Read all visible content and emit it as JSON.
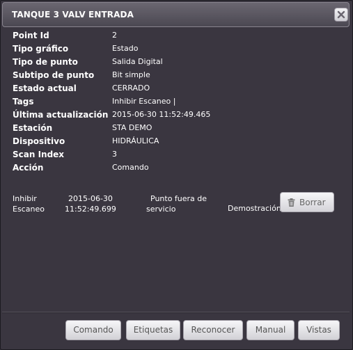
{
  "dialog": {
    "title": "TANQUE 3 VALV ENTRADA",
    "close_icon": "close-icon"
  },
  "properties": [
    {
      "label": "Point Id",
      "value": "2"
    },
    {
      "label": "Tipo gráfico",
      "value": "Estado"
    },
    {
      "label": "Tipo de punto",
      "value": "Salida Digital"
    },
    {
      "label": "Subtipo de punto",
      "value": "Bit simple"
    },
    {
      "label": "Estado actual",
      "value": "CERRADO"
    },
    {
      "label": "Tags",
      "value": "Inhibir Escaneo |"
    },
    {
      "label": "Última actualización",
      "value": "2015-06-30 11:52:49.465"
    },
    {
      "label": "Estación",
      "value": "STA DEMO"
    },
    {
      "label": "Dispositivo",
      "value": "HIDRÁULICA"
    },
    {
      "label": "Scan Index",
      "value": "3"
    },
    {
      "label": "Acción",
      "value": "Comando"
    }
  ],
  "event": {
    "type_line1": "Inhibir",
    "type_line2": "Escaneo",
    "date_line1": "2015-06-30",
    "date_line2": "11:52:49.699",
    "desc_line1": "Punto fuera de",
    "desc_line2": "servicio",
    "station": "Demostración",
    "delete_label": "Borrar",
    "delete_icon": "trash-icon"
  },
  "footer": {
    "buttons": [
      "Comando",
      "Etiquetas",
      "Reconocer",
      "Manual",
      "Vistas"
    ]
  }
}
